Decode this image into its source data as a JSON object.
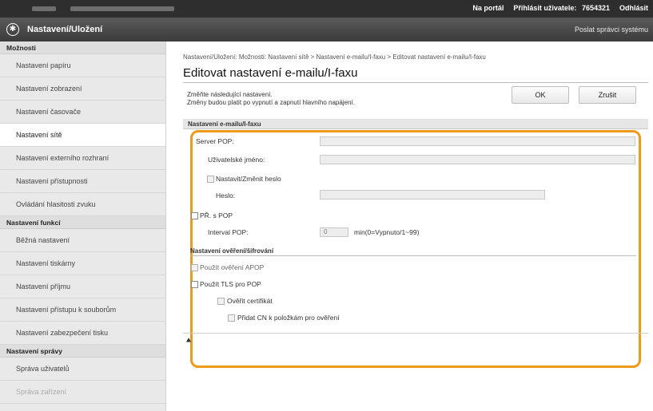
{
  "topbar": {
    "portal_link": "Na portál",
    "user_label": "Přihlásit uživatele:",
    "user_id": "7654321",
    "logout": "Odhlásit"
  },
  "appbar": {
    "title": "Nastavení/Uložení",
    "admin_link": "Poslat správci systému"
  },
  "sidebar": {
    "sections": [
      {
        "header": "Možnosti",
        "items": [
          "Nastavení papíru",
          "Nastavení zobrazení",
          "Nastavení časovače",
          "Nastavení sítě",
          "Nastavení externího rozhraní",
          "Nastavení přístupnosti",
          "Ovládání hlasitosti zvuku"
        ],
        "active_index": 3
      },
      {
        "header": "Nastavení funkcí",
        "items": [
          "Běžná nastavení",
          "Nastavení tiskárny",
          "Nastavení příjmu",
          "Nastavení přístupu k souborům",
          "Nastavení zabezpečení tisku"
        ]
      },
      {
        "header": "Nastavení správy",
        "items": [
          "Správa uživatelů",
          "Správa zařízení"
        ]
      }
    ]
  },
  "main": {
    "breadcrumb": "Nastavení/Uložení: Možnosti: Nastavení sítě > Nastavení e-mailu/I-faxu > Editovat nastavení e-mailu/I-faxu",
    "title": "Editovat nastavení e-mailu/I-faxu",
    "desc_line1": "Změňte následující nastavení.",
    "desc_line2": "Změny budou platit po vypnutí a zapnutí hlavního napájení.",
    "ok_label": "OK",
    "cancel_label": "Zrušit",
    "section_title": "Nastavení e-mailu/I-faxu",
    "pop_server_label": "Server POP:",
    "username_label": "Uživatelské jméno:",
    "set_password_label": "Nastavit/Změnit heslo",
    "password_label": "Heslo:",
    "pop_before_smtp_label": "PŘ. s POP",
    "pop_interval_label": "Interval POP:",
    "pop_interval_value": "0",
    "pop_interval_unit": "min(0=Vypnuto/1~99)",
    "auth_section_title": "Nastavení ověření/šifrování",
    "apop_label": "Použít ověření APOP",
    "tls_label": "Použít TLS pro POP",
    "verify_cert_label": "Ověřit certifikát",
    "add_cn_label": "Přidat CN k položkám pro ověření",
    "top_link": "⯅"
  }
}
